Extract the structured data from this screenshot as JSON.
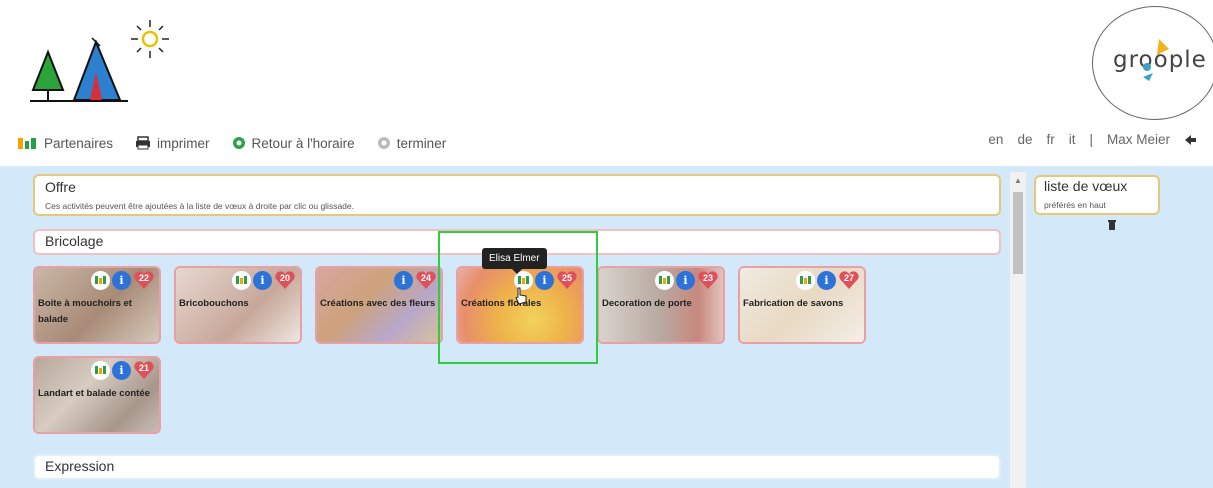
{
  "toolbar": {
    "partners_label": "Partenaires",
    "print_label": "imprimer",
    "back_label": "Retour à l'horaire",
    "finish_label": "terminer",
    "languages": [
      "en",
      "de",
      "fr",
      "it"
    ],
    "separator": "|",
    "user_name": "Max Meier"
  },
  "logo": {
    "brand_text": "groople"
  },
  "offer": {
    "title": "Offre",
    "description": "Ces activités peuvent être ajoutées à la liste de vœux à droite par clic ou glissade."
  },
  "categories": [
    {
      "label": "Bricolage",
      "activities": [
        {
          "name": "Boite à mouchoirs et balade",
          "count": "22",
          "has_partner_icon": true
        },
        {
          "name": "Bricobouchons",
          "count": "20",
          "has_partner_icon": true
        },
        {
          "name": "Créations avec des fleurs",
          "count": "24",
          "has_partner_icon": false
        },
        {
          "name": "Créations florales",
          "count": "25",
          "has_partner_icon": true
        },
        {
          "name": "Decoration de porte",
          "count": "23",
          "has_partner_icon": true
        },
        {
          "name": "Fabrication de savons",
          "count": "27",
          "has_partner_icon": true
        },
        {
          "name": "Landart et balade contée",
          "count": "21",
          "has_partner_icon": true
        }
      ]
    },
    {
      "label": "Expression"
    }
  ],
  "tooltip": {
    "text": "Elisa Elmer"
  },
  "wishlist": {
    "title": "liste de vœux",
    "subtitle": "préférés en haut"
  },
  "colors": {
    "accent_blue": "#2d72d9",
    "heart_red": "#e0505b",
    "panel_border_gold": "#e6c77b",
    "main_background": "#d3e9f9",
    "highlight_green": "#2ecc40"
  },
  "icons": [
    "partners-icon",
    "printer-icon",
    "back-circle-icon",
    "finish-circle-icon",
    "logout-icon",
    "info-icon",
    "heart-icon",
    "trash-icon",
    "sun-icon",
    "tent-icon",
    "tree-icon"
  ]
}
